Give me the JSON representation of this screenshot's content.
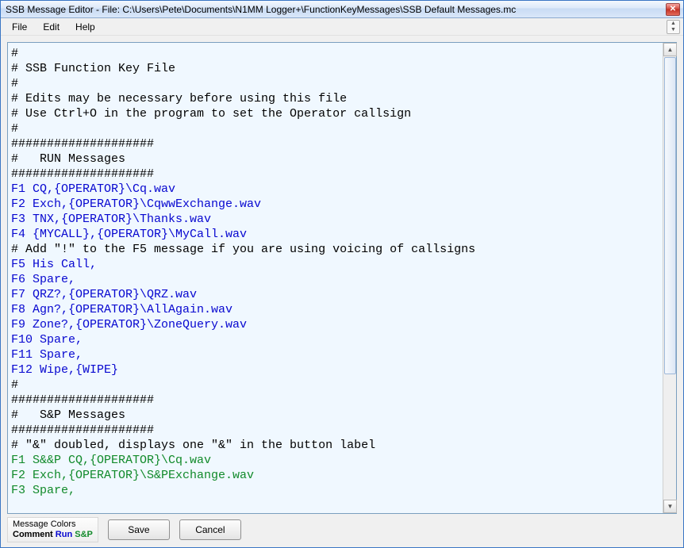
{
  "window": {
    "title": "SSB Message Editor - File: C:\\Users\\Pete\\Documents\\N1MM Logger+\\FunctionKeyMessages\\SSB Default Messages.mc",
    "close_glyph": "✕"
  },
  "menu": {
    "file": "File",
    "edit": "Edit",
    "help": "Help"
  },
  "editor": {
    "lines": [
      {
        "t": "comment",
        "s": "#"
      },
      {
        "t": "comment",
        "s": "# SSB Function Key File"
      },
      {
        "t": "comment",
        "s": "#"
      },
      {
        "t": "comment",
        "s": "# Edits may be necessary before using this file"
      },
      {
        "t": "comment",
        "s": "# Use Ctrl+O in the program to set the Operator callsign"
      },
      {
        "t": "comment",
        "s": "#"
      },
      {
        "t": "comment",
        "s": "####################"
      },
      {
        "t": "comment",
        "s": "#   RUN Messages"
      },
      {
        "t": "comment",
        "s": "####################"
      },
      {
        "t": "run",
        "s": "F1 CQ,{OPERATOR}\\Cq.wav"
      },
      {
        "t": "run",
        "s": "F2 Exch,{OPERATOR}\\CqwwExchange.wav"
      },
      {
        "t": "run",
        "s": "F3 TNX,{OPERATOR}\\Thanks.wav"
      },
      {
        "t": "run",
        "s": "F4 {MYCALL},{OPERATOR}\\MyCall.wav"
      },
      {
        "t": "comment",
        "s": "# Add \"!\" to the F5 message if you are using voicing of callsigns"
      },
      {
        "t": "run",
        "s": "F5 His Call,"
      },
      {
        "t": "run",
        "s": "F6 Spare,"
      },
      {
        "t": "run",
        "s": "F7 QRZ?,{OPERATOR}\\QRZ.wav"
      },
      {
        "t": "run",
        "s": "F8 Agn?,{OPERATOR}\\AllAgain.wav"
      },
      {
        "t": "run",
        "s": "F9 Zone?,{OPERATOR}\\ZoneQuery.wav"
      },
      {
        "t": "run",
        "s": "F10 Spare,"
      },
      {
        "t": "run",
        "s": "F11 Spare,"
      },
      {
        "t": "run",
        "s": "F12 Wipe,{WIPE}"
      },
      {
        "t": "comment",
        "s": "#"
      },
      {
        "t": "comment",
        "s": "####################"
      },
      {
        "t": "comment",
        "s": "#   S&P Messages"
      },
      {
        "t": "comment",
        "s": "####################"
      },
      {
        "t": "comment",
        "s": "# \"&\" doubled, displays one \"&\" in the button label"
      },
      {
        "t": "sp",
        "s": "F1 S&&P CQ,{OPERATOR}\\Cq.wav"
      },
      {
        "t": "sp",
        "s": "F2 Exch,{OPERATOR}\\S&PExchange.wav"
      },
      {
        "t": "sp",
        "s": "F3 Spare,"
      }
    ]
  },
  "legend": {
    "title": "Message Colors",
    "comment": "Comment",
    "run": "Run",
    "sp": "S&P"
  },
  "buttons": {
    "save": "Save",
    "cancel": "Cancel"
  }
}
